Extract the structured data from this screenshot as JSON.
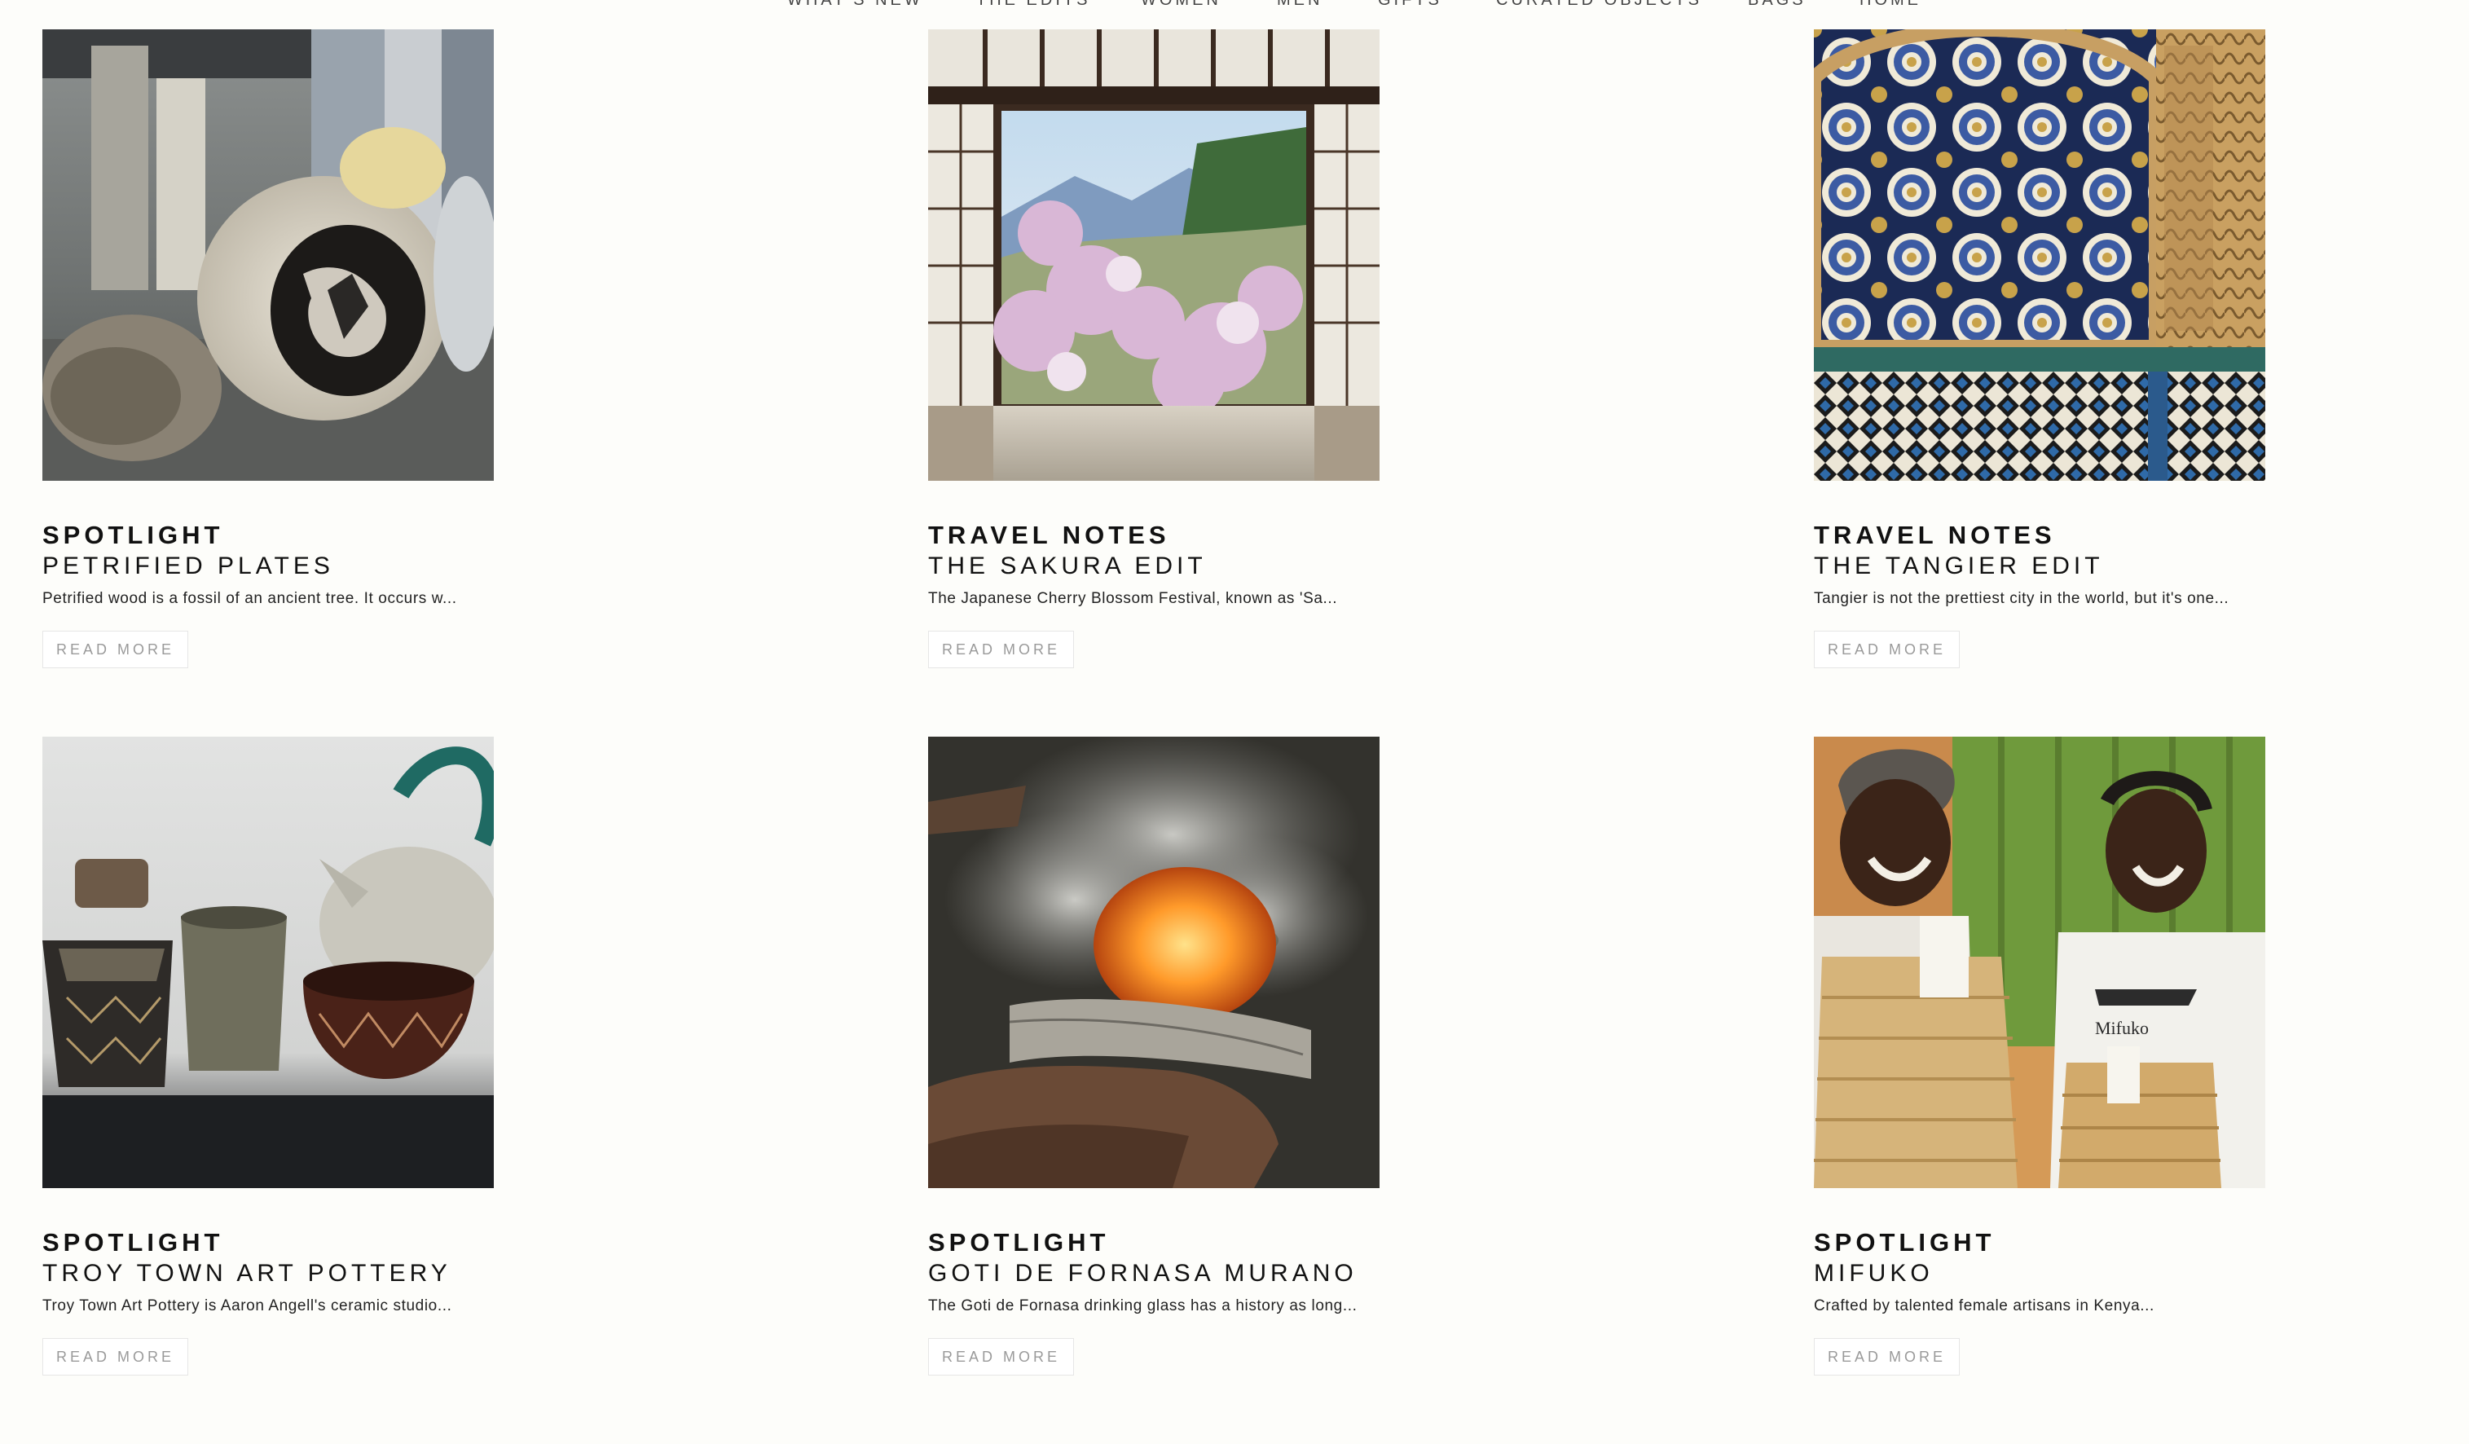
{
  "nav": {
    "items": [
      {
        "label": "WHAT'S NEW"
      },
      {
        "label": "THE EDITS"
      },
      {
        "label": "WOMEN"
      },
      {
        "label": "MEN"
      },
      {
        "label": "GIFTS"
      },
      {
        "label": "CURATED OBJECTS"
      },
      {
        "label": "BAGS"
      },
      {
        "label": "HOME"
      }
    ]
  },
  "articles": [
    {
      "category": "SPOTLIGHT",
      "title": "PETRIFIED PLATES",
      "excerpt": "Petrified wood is a fossil of an ancient tree. It occurs w...",
      "cta": "READ MORE"
    },
    {
      "category": "TRAVEL NOTES",
      "title": "THE SAKURA EDIT",
      "excerpt": "The Japanese Cherry Blossom Festival, known as 'Sa...",
      "cta": "READ MORE"
    },
    {
      "category": "TRAVEL NOTES",
      "title": "THE TANGIER EDIT",
      "excerpt": "Tangier is not the prettiest city in the world, but it's one...",
      "cta": "READ MORE"
    },
    {
      "category": "SPOTLIGHT",
      "title": "TROY TOWN ART POTTERY",
      "excerpt": "Troy Town Art Pottery is Aaron Angell's ceramic studio...",
      "cta": "READ MORE"
    },
    {
      "category": "SPOTLIGHT",
      "title": "GOTI DE FORNASA MURANO",
      "excerpt": "The Goti de Fornasa drinking glass has a history as long...",
      "cta": "READ MORE"
    },
    {
      "category": "SPOTLIGHT",
      "title": "MIFUKO",
      "excerpt": "Crafted by talented female artisans in Kenya...",
      "cta": "READ MORE"
    }
  ],
  "photo_text": {
    "mifuko_shirt": "Mifuko"
  },
  "colors": {
    "background": "#fdfdfa",
    "text": "#111111",
    "button_text": "#9a9a9a",
    "button_border": "#e6e6e6"
  }
}
